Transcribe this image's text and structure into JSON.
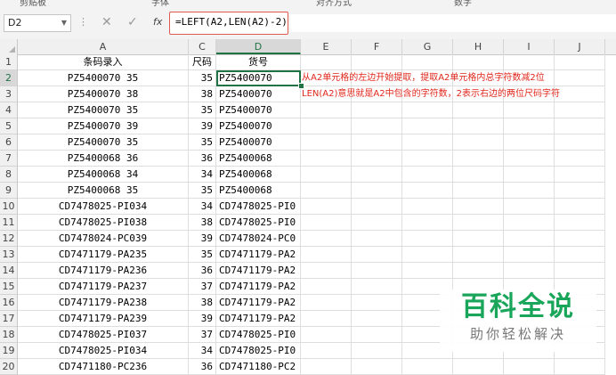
{
  "ribbon": {
    "labels": [
      "剪贴板",
      "字体",
      "对齐方式",
      "数字"
    ]
  },
  "formula_bar": {
    "name_box": "D2",
    "fx": "fx",
    "cancel": "✕",
    "enter": "✓",
    "formula": "=LEFT(A2,LEN(A2)-2)"
  },
  "columns": [
    "A",
    "C",
    "D",
    "E",
    "F",
    "G",
    "H",
    "I",
    "J"
  ],
  "header_row": {
    "a": "条码录入",
    "c": "尺码",
    "d": "货号"
  },
  "rows": [
    {
      "n": "2",
      "a": "PZ5400070 35",
      "c": "35",
      "d": "PZ5400070"
    },
    {
      "n": "3",
      "a": "PZ5400070 38",
      "c": "38",
      "d": "PZ5400070"
    },
    {
      "n": "4",
      "a": "PZ5400070 35",
      "c": "35",
      "d": "PZ5400070"
    },
    {
      "n": "5",
      "a": "PZ5400070 39",
      "c": "39",
      "d": "PZ5400070"
    },
    {
      "n": "6",
      "a": "PZ5400070 35",
      "c": "35",
      "d": "PZ5400070"
    },
    {
      "n": "7",
      "a": "PZ5400068 36",
      "c": "36",
      "d": "PZ5400068"
    },
    {
      "n": "8",
      "a": "PZ5400068 34",
      "c": "34",
      "d": "PZ5400068"
    },
    {
      "n": "9",
      "a": "PZ5400068 35",
      "c": "35",
      "d": "PZ5400068"
    },
    {
      "n": "10",
      "a": "CD7478025-PI034",
      "c": "34",
      "d": "CD7478025-PI0"
    },
    {
      "n": "11",
      "a": "CD7478025-PI038",
      "c": "38",
      "d": "CD7478025-PI0"
    },
    {
      "n": "12",
      "a": "CD7478024-PC039",
      "c": "39",
      "d": "CD7478024-PC0"
    },
    {
      "n": "13",
      "a": "CD7471179-PA235",
      "c": "35",
      "d": "CD7471179-PA2"
    },
    {
      "n": "14",
      "a": "CD7471179-PA236",
      "c": "36",
      "d": "CD7471179-PA2"
    },
    {
      "n": "15",
      "a": "CD7471179-PA237",
      "c": "37",
      "d": "CD7471179-PA2"
    },
    {
      "n": "16",
      "a": "CD7471179-PA238",
      "c": "38",
      "d": "CD7471179-PA2"
    },
    {
      "n": "17",
      "a": "CD7471179-PA239",
      "c": "39",
      "d": "CD7471179-PA2"
    },
    {
      "n": "18",
      "a": "CD7478025-PI037",
      "c": "37",
      "d": "CD7478025-PI0"
    },
    {
      "n": "19",
      "a": "CD7478025-PI034",
      "c": "34",
      "d": "CD7478025-PI0"
    },
    {
      "n": "20",
      "a": "CD7471180-PC236",
      "c": "36",
      "d": "CD7471180-PC2"
    }
  ],
  "notes": {
    "line1": "从A2单元格的左边开始提取，提取A2单元格内总字符数减2位",
    "line2": "LEN(A2)意思就是A2中包含的字符数，2表示右边的两位尺码字符"
  },
  "watermark": {
    "title": "百科全说",
    "subtitle": "助你轻松解决"
  },
  "colors": {
    "selection": "#217346",
    "note": "#e0271b",
    "formula_border": "#e05a4f",
    "watermark": "#1aa65a"
  }
}
